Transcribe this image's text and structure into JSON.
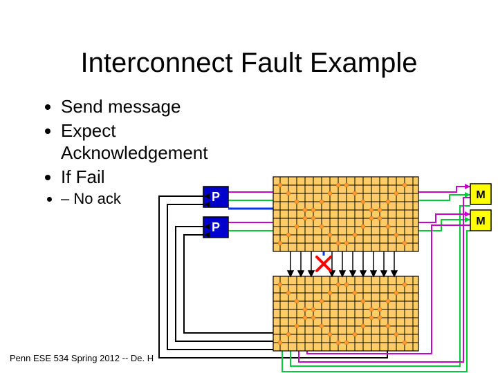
{
  "title": "Interconnect Fault Example",
  "bullets": {
    "b1": "Send message",
    "b2": "Expect Acknowledgement",
    "b3": "If Fail",
    "sub1": "No ack"
  },
  "footer": "Penn ESE 534 Spring 2012 -- De. H",
  "labels": {
    "p": "P",
    "m": "M"
  },
  "colors": {
    "p_fill": "#0000cc",
    "m_fill": "#ffff00",
    "wire_green": "#00cc33",
    "wire_magenta": "#cc00cc",
    "wire_blue": "#0033ff",
    "wire_black": "#000000",
    "crossbar_fill": "#ffcc66",
    "fault_red": "#ff0000"
  }
}
